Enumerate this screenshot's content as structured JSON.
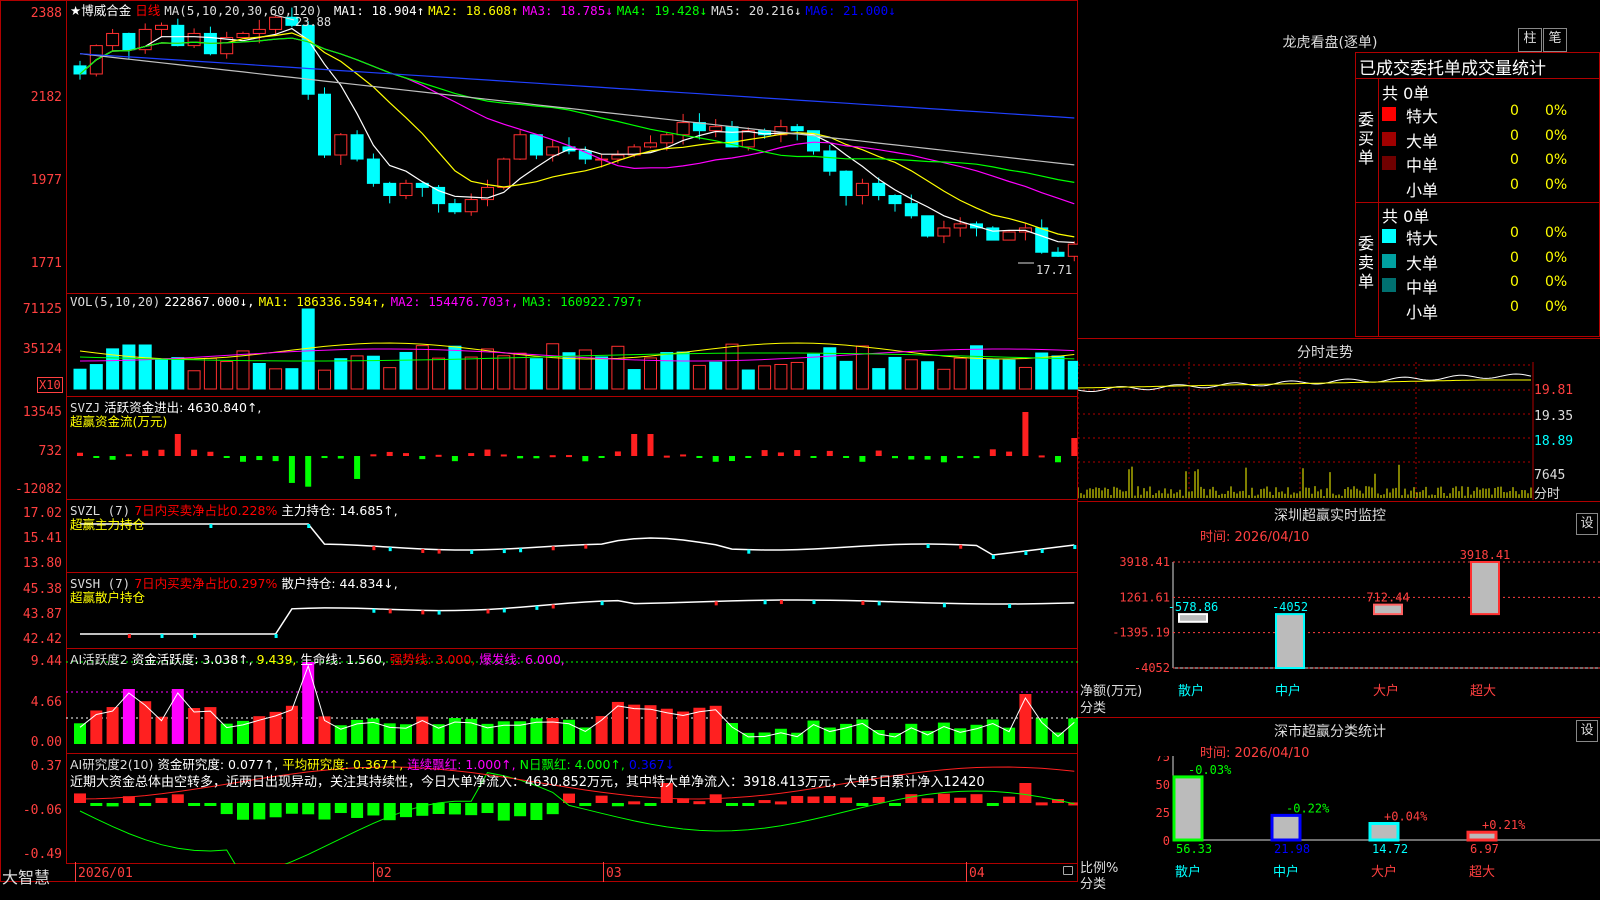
{
  "main": {
    "title": "★博威合金",
    "period": "日线",
    "ma_header": "MA(5,10,20,30,60,120)",
    "ma": [
      {
        "label": "MA1: 18.904↑",
        "color": "#ffffff"
      },
      {
        "label": "MA2: 18.608↑",
        "color": "#ffff00"
      },
      {
        "label": "MA3: 18.785↓",
        "color": "#ff00ff"
      },
      {
        "label": "MA4: 19.428↓",
        "color": "#00ff00"
      },
      {
        "label": "MA5: 20.216↓",
        "color": "#c0c0c0"
      },
      {
        "label": "MA6: 21.000↓",
        "color": "#0000ff"
      }
    ],
    "y_ticks": [
      "2388",
      "2182",
      "1977",
      "1771"
    ],
    "high_mark": "23.88",
    "low_mark": "17.71"
  },
  "vol": {
    "header": "VOL(5,10,20)",
    "value": "222867.000↓,",
    "ma1": "MA1: 186336.594↑,",
    "ma2": "MA2: 154476.703↑,",
    "ma3": "MA3: 160922.797↑",
    "y_ticks": [
      "71125",
      "35124"
    ],
    "unit": "X10"
  },
  "svzj": {
    "header": "SVZJ",
    "line1": "活跃资金进出: 4630.840↑,",
    "line2": "超赢资金流(万元)",
    "y_ticks": [
      "13545",
      "732",
      "-12082"
    ]
  },
  "svzl": {
    "header": "SVZL (7)",
    "red": "7日内买卖净占比0.228%",
    "white": "主力持仓: 14.685↑,",
    "line2": "超赢主力持仓",
    "y_ticks": [
      "17.02",
      "15.41",
      "13.80"
    ]
  },
  "svsh": {
    "header": "SVSH (7)",
    "red": "7日内买卖净占比0.297%",
    "white": "散户持仓: 44.834↓,",
    "line2": "超赢散户持仓",
    "y_ticks": [
      "45.38",
      "43.87",
      "42.42"
    ]
  },
  "ai1": {
    "header": "AI活跃度2",
    "a": "资金活跃度: 3.038↑,",
    "b": "9.439,",
    "c": "生命线: 1.560,",
    "d": "强势线: 3.000,",
    "e": "爆发线: 6.000,",
    "y_ticks": [
      "9.44",
      "4.66",
      "0.00"
    ]
  },
  "ai2": {
    "header": "AI研究度2(10)",
    "a": "资金研究度: 0.077↑,",
    "b": "平均研究度: 0.367↑,",
    "c": "连续飘红: 1.000↑,",
    "d": "N日飘红: 4.000↑,",
    "e": "0.367↓",
    "note": "近期大资金总体由空转多，近两日出现异动，关注其持续性，今日大单净流入：4630.852万元，其中特大单净流入：3918.413万元，大单5日累计净入12420",
    "y_ticks": [
      "0.37",
      "-0.06",
      "-0.49"
    ]
  },
  "xaxis": {
    "labels": [
      "2026/01",
      "02",
      "03",
      "04"
    ],
    "brand": "大智慧"
  },
  "dragon": {
    "title": "龙虎看盘(逐单)",
    "btn1": "柱",
    "btn2": "笔",
    "sub": "已成交委托单成交量统计",
    "buy_total": "共 0单",
    "sell_total": "共 0单",
    "buy_label": "委买单",
    "sell_label": "委卖单",
    "buy_rows": [
      {
        "name": "特大",
        "n": "0",
        "p": "0%",
        "color": "#ff0000"
      },
      {
        "name": "大单",
        "n": "0",
        "p": "0%",
        "color": "#a00000"
      },
      {
        "name": "中单",
        "n": "0",
        "p": "0%",
        "color": "#700000"
      },
      {
        "name": "小单",
        "n": "0",
        "p": "0%",
        "color": "#000000"
      }
    ],
    "sell_rows": [
      {
        "name": "特大",
        "n": "0",
        "p": "0%",
        "color": "#00ffff"
      },
      {
        "name": "大单",
        "n": "0",
        "p": "0%",
        "color": "#00a0a0"
      },
      {
        "name": "中单",
        "n": "0",
        "p": "0%",
        "color": "#007070"
      },
      {
        "name": "小单",
        "n": "0",
        "p": "0%",
        "color": "#000000"
      }
    ]
  },
  "intraday": {
    "title": "分时走势",
    "ticks": [
      "19.81",
      "19.35",
      "18.89",
      "7645"
    ],
    "unit": "分时"
  },
  "sz_monitor": {
    "title": "深圳超赢实时监控",
    "btn": "设",
    "time": "时间: 2026/04/10",
    "y_ticks": [
      "3918.41",
      "1261.61",
      "-1395.19",
      "-4052"
    ],
    "ylabel": "净额(万元)",
    "xlabel": "分类",
    "cats": [
      "散户",
      "中户",
      "大户",
      "超大"
    ],
    "vals": [
      "-578.86",
      "-4052",
      "712.44",
      "3918.41"
    ]
  },
  "sz_stats": {
    "title": "深市超赢分类统计",
    "btn": "设",
    "time": "时间: 2026/04/10",
    "y_ticks": [
      "75",
      "50",
      "25",
      "0"
    ],
    "ylabel": "比例%",
    "xlabel": "分类",
    "cats": [
      "散户",
      "中户",
      "大户",
      "超大"
    ],
    "vals": [
      "56.33",
      "21.98",
      "14.72",
      "6.97"
    ],
    "chg": [
      "-0.03%",
      "-0.22%",
      "+0.04%",
      "+0.21%"
    ]
  },
  "chart_data": [
    {
      "type": "bar",
      "title": "深圳超赢实时监控",
      "ylabel": "净额(万元)",
      "xlabel": "分类",
      "categories": [
        "散户",
        "中户",
        "大户",
        "超大"
      ],
      "values": [
        -578.86,
        -4052,
        712.44,
        3918.41
      ],
      "ylim": [
        -4052,
        3918.41
      ]
    },
    {
      "type": "bar",
      "title": "深市超赢分类统计",
      "ylabel": "比例%",
      "xlabel": "分类",
      "categories": [
        "散户",
        "中户",
        "大户",
        "超大"
      ],
      "values": [
        56.33,
        21.98,
        14.72,
        6.97
      ],
      "ylim": [
        0,
        75
      ]
    }
  ]
}
